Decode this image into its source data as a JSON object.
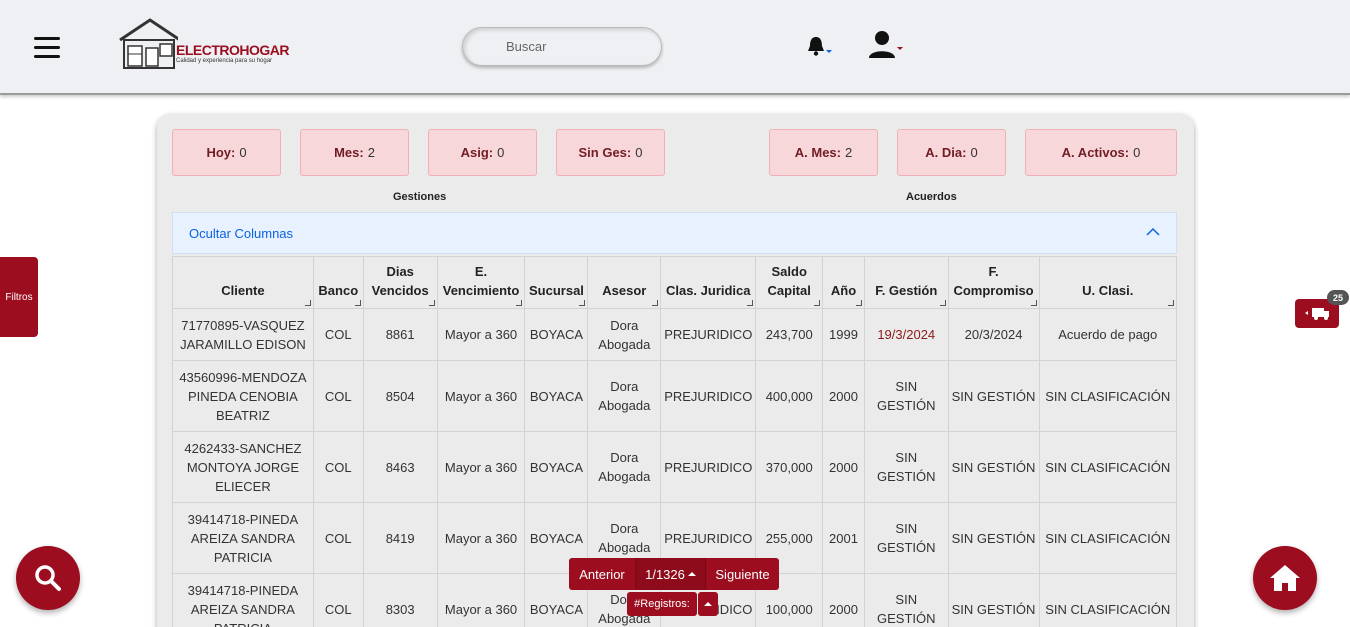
{
  "header": {
    "logo_title": "ELECTROHOGAR",
    "logo_subtitle": "Calidad y experiencia para su hogar",
    "search_placeholder": "Buscar"
  },
  "side": {
    "filtros_label": "Filtros",
    "right_badge": "25"
  },
  "stats": {
    "gestiones": [
      {
        "label": "Hoy:",
        "value": "0"
      },
      {
        "label": "Mes:",
        "value": "2"
      },
      {
        "label": "Asig:",
        "value": "0"
      },
      {
        "label": "Sin Ges:",
        "value": "0"
      }
    ],
    "acuerdos": [
      {
        "label": "A. Mes:",
        "value": "2"
      },
      {
        "label": "A. Dia:",
        "value": "0"
      },
      {
        "label": "A. Activos:",
        "value": "0"
      }
    ],
    "gestiones_caption": "Gestiones",
    "acuerdos_caption": "Acuerdos"
  },
  "accordion": {
    "label": "Ocultar Columnas"
  },
  "table": {
    "headers": [
      "Cliente",
      "Banco",
      "Dias Vencidos",
      "E. Vencimiento",
      "Sucursal",
      "Asesor",
      "Clas. Juridica",
      "Saldo Capital",
      "Año",
      "F. Gestión",
      "F. Compromiso",
      "U. Clasi."
    ],
    "rows": [
      [
        "71770895-VASQUEZ JARAMILLO EDISON",
        "COL",
        "8861",
        "Mayor a 360",
        "BOYACA",
        "Dora Abogada",
        "PREJURIDICO",
        "243,700",
        "1999",
        "19/3/2024",
        "20/3/2024",
        "Acuerdo de pago"
      ],
      [
        "43560996-MENDOZA PINEDA CENOBIA BEATRIZ",
        "COL",
        "8504",
        "Mayor a 360",
        "BOYACA",
        "Dora Abogada",
        "PREJURIDICO",
        "400,000",
        "2000",
        "SIN GESTIÓN",
        "SIN GESTIÓN",
        "SIN CLASIFICACIÓN"
      ],
      [
        "4262433-SANCHEZ MONTOYA JORGE ELIECER",
        "COL",
        "8463",
        "Mayor a 360",
        "BOYACA",
        "Dora Abogada",
        "PREJURIDICO",
        "370,000",
        "2000",
        "SIN GESTIÓN",
        "SIN GESTIÓN",
        "SIN CLASIFICACIÓN"
      ],
      [
        "39414718-PINEDA AREIZA SANDRA PATRICIA",
        "COL",
        "8419",
        "Mayor a 360",
        "BOYACA",
        "Dora Abogada",
        "PREJURIDICO",
        "255,000",
        "2001",
        "SIN GESTIÓN",
        "SIN GESTIÓN",
        "SIN CLASIFICACIÓN"
      ],
      [
        "39414718-PINEDA AREIZA SANDRA PATRICIA",
        "COL",
        "8303",
        "Mayor a 360",
        "BOYACA",
        "Dora Abogada",
        "PREJURIDICO",
        "100,000",
        "2000",
        "SIN GESTIÓN",
        "SIN GESTIÓN",
        "SIN CLASIFICACIÓN"
      ]
    ]
  },
  "pager": {
    "prev_label": "Anterior",
    "page_label": "1/1326",
    "next_label": "Siguiente",
    "registros_label": "#Registros:"
  },
  "colors": {
    "brand": "#9b0d1f",
    "stat_bg": "#f8d7da",
    "accordion_bg": "#e7f1ff"
  },
  "icons": [
    "hamburger-icon",
    "bell-icon",
    "user-icon",
    "chevron-up-icon",
    "search-icon",
    "home-icon",
    "truck-icon"
  ]
}
